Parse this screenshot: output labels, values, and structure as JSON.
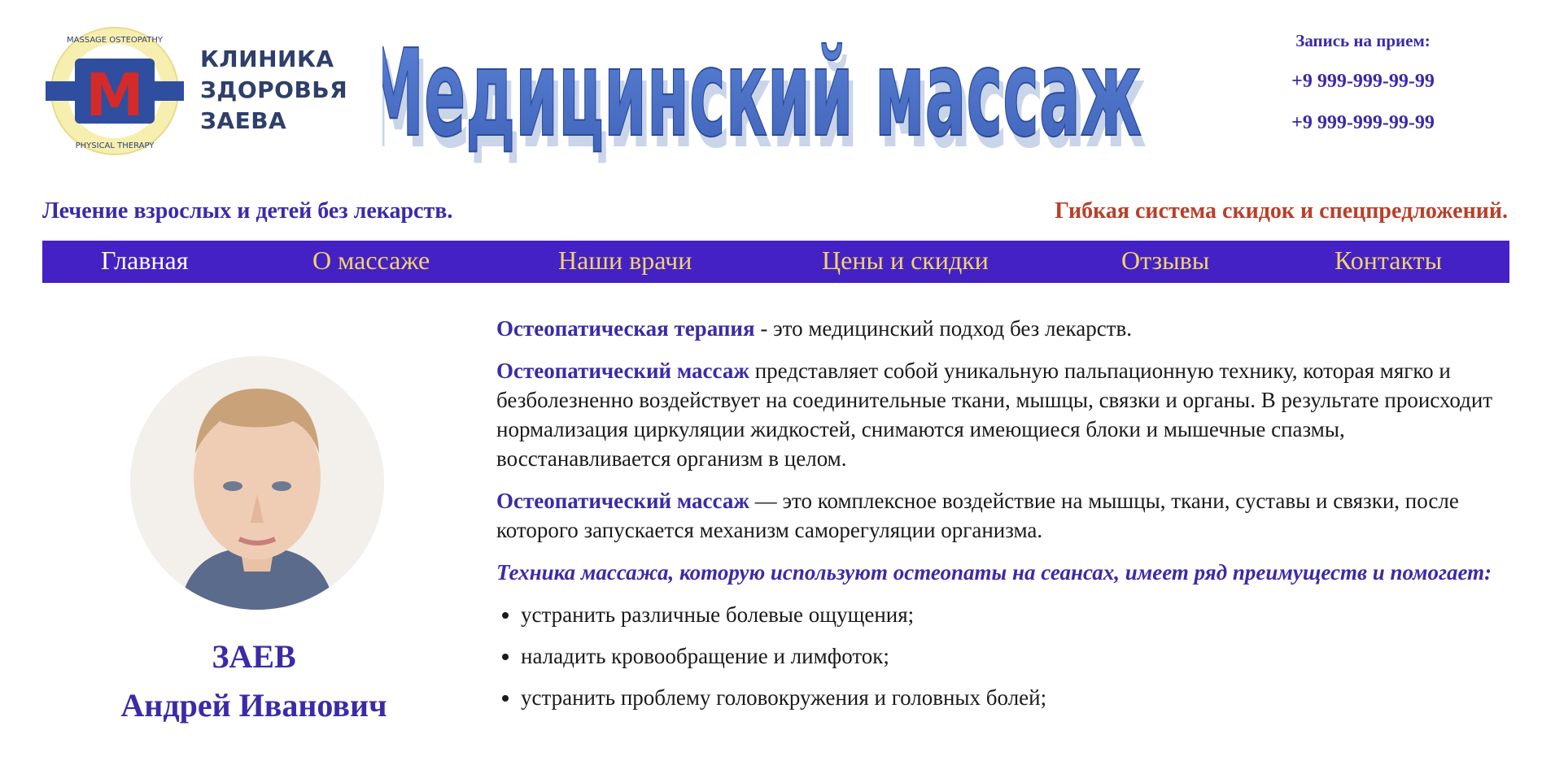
{
  "header": {
    "logo_ring_top": "MASSAGE   OSTEOPATHY",
    "logo_ring_bottom": "PHYSICAL THERAPY",
    "logo_mark": "M",
    "clinic_name_lines": [
      "КЛИНИКА",
      "ЗДОРОВЬЯ",
      "ЗАЕВА"
    ],
    "title": "Медицинский массаж",
    "appointment_label": "Запись на прием:",
    "phones": [
      "+9 999-999-99-99",
      "+9 999-999-99-99"
    ]
  },
  "taglines": {
    "left": "Лечение взрослых и детей без лекарств.",
    "right": "Гибкая система скидок и спецпредложений."
  },
  "nav": {
    "items": [
      {
        "label": "Главная",
        "active": true
      },
      {
        "label": "О массаже",
        "active": false
      },
      {
        "label": "Наши врачи",
        "active": false
      },
      {
        "label": "Цены и скидки",
        "active": false
      },
      {
        "label": "Отзывы",
        "active": false
      },
      {
        "label": "Контакты",
        "active": false
      }
    ]
  },
  "doctor": {
    "surname": "ЗАЕВ",
    "name": "Андрей Иванович"
  },
  "content": {
    "p1_hl": "Остеопатическая терапия",
    "p1_text": " - это медицинский подход без лекарств.",
    "p2_hl": "Остеопатический массаж",
    "p2_text": " представляет собой уникальную пальпационную технику, которая мягко и безболезненно воздействует на соединительные ткани, мышцы, связки и органы. В результате происходит нормализация циркуляции жидкостей, снимаются имеющиеся блоки и мышечные спазмы, восстанавливается организм в целом.",
    "p3_hl": "Остеопатический массаж",
    "p3_text": " — это комплексное воздействие на мышцы, ткани, суставы и связки, после которого запускается механизм саморегуляции организма.",
    "emph": "Техника массажа, которую используют остеопаты на сеансах, имеет ряд преимуществ и помогает:",
    "bullets": [
      "устранить различные болевые ощущения;",
      "наладить кровообращение и лимфоток;",
      "устранить проблему головокружения и головных болей;"
    ]
  },
  "colors": {
    "accent": "#3b2aa8",
    "nav_bg": "#4421c4",
    "nav_text": "#f2d36a",
    "promo": "#b8402a",
    "title_blue": "#4a6fc4"
  }
}
